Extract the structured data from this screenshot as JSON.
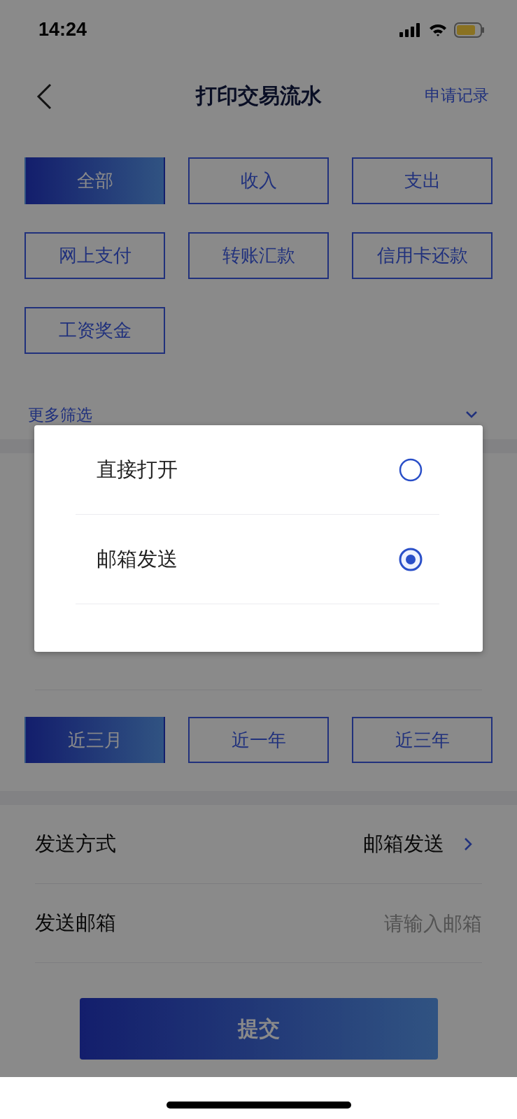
{
  "status_bar": {
    "time": "14:24"
  },
  "nav": {
    "title": "打印交易流水",
    "action": "申请记录"
  },
  "type_filters": [
    {
      "label": "全部",
      "selected": true
    },
    {
      "label": "收入",
      "selected": false
    },
    {
      "label": "支出",
      "selected": false
    },
    {
      "label": "网上支付",
      "selected": false
    },
    {
      "label": "转账汇款",
      "selected": false
    },
    {
      "label": "信用卡还款",
      "selected": false
    },
    {
      "label": "工资奖金",
      "selected": false
    }
  ],
  "more_filters": {
    "label": "更多筛选",
    "expanded": false
  },
  "periods": [
    {
      "label": "近三月",
      "selected": true
    },
    {
      "label": "近一年",
      "selected": false
    },
    {
      "label": "近三年",
      "selected": false
    }
  ],
  "send_method": {
    "label": "发送方式",
    "value": "邮箱发送"
  },
  "email": {
    "label": "发送邮箱",
    "placeholder": "请输入邮箱"
  },
  "submit": "提交",
  "dialog": {
    "options": [
      {
        "label": "直接打开",
        "selected": false
      },
      {
        "label": "邮箱发送",
        "selected": true
      }
    ]
  }
}
